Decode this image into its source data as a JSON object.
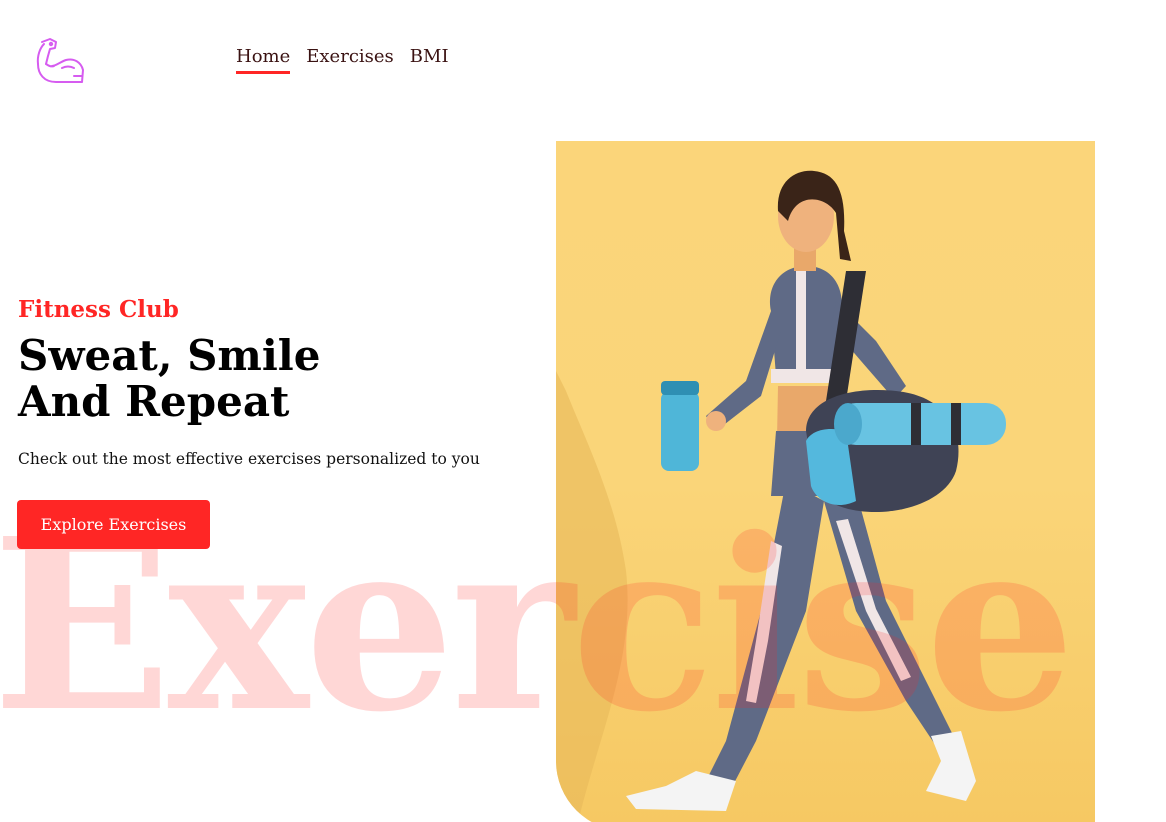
{
  "nav": {
    "logo_icon": "flexed-arm-icon",
    "links": [
      {
        "label": "Home",
        "active": true
      },
      {
        "label": "Exercises",
        "active": false
      },
      {
        "label": "BMI",
        "active": false
      }
    ]
  },
  "hero": {
    "subtitle": "Fitness Club",
    "title_line1": "Sweat, Smile",
    "title_line2": "And Repeat",
    "description": "Check out the most effective exercises personalized to you",
    "button_label": "Explore Exercises",
    "watermark": "Exercise",
    "image_alt": "woman-walking-with-gym-bag-and-water-bottle"
  },
  "colors": {
    "accent": "#ff2625",
    "image_bg": "#fad579",
    "logo": "#d65cf0"
  }
}
